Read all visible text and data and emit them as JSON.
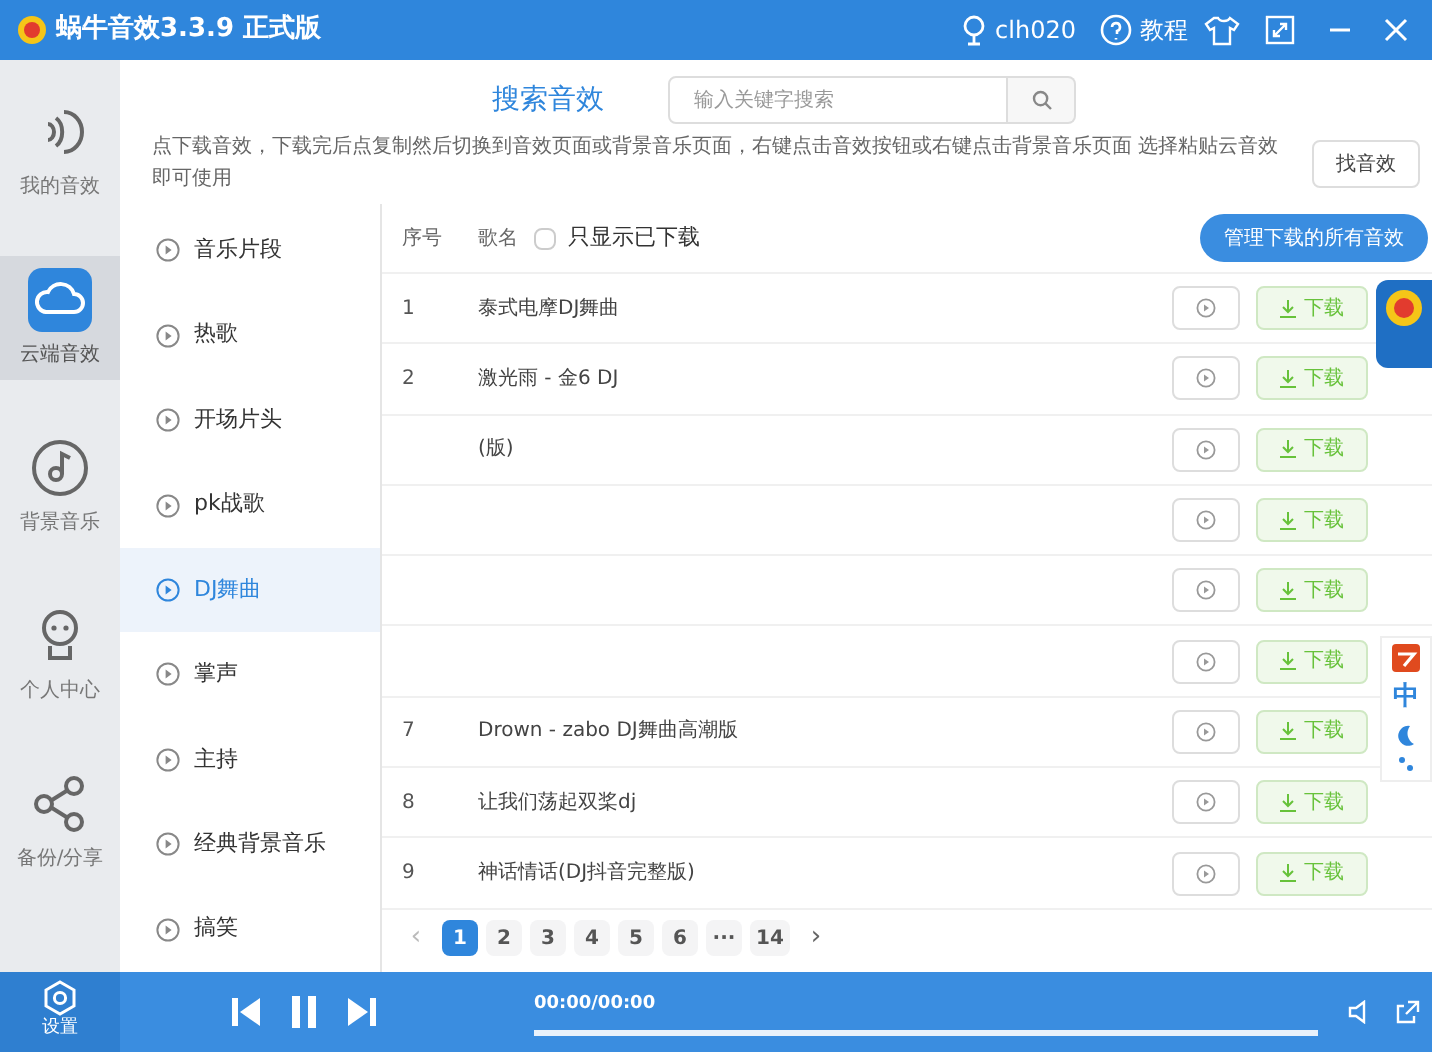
{
  "window": {
    "title": "蜗牛音效3.3.9 正式版",
    "user": "clh020",
    "help": "教程"
  },
  "nav": [
    {
      "label": "我的音效",
      "kind": "sound",
      "selected": false
    },
    {
      "label": "云端音效",
      "kind": "cloud",
      "selected": true
    },
    {
      "label": "背景音乐",
      "kind": "disc",
      "selected": false
    },
    {
      "label": "个人中心",
      "kind": "person",
      "selected": false
    },
    {
      "label": "备份/分享",
      "kind": "share",
      "selected": false
    }
  ],
  "settings": {
    "label": "设置"
  },
  "search": {
    "title": "搜索音效",
    "placeholder": "输入关键字搜索"
  },
  "notice": "点下载音效，下载完后点复制然后切换到音效页面或背景音乐页面，右键点击音效按钮或右键点击背景音乐页面 选择粘贴云音效即可使用",
  "find_button": "找音效",
  "categories": [
    {
      "label": "音乐片段",
      "selected": false
    },
    {
      "label": "热歌",
      "selected": false
    },
    {
      "label": "开场片头",
      "selected": false
    },
    {
      "label": "pk战歌",
      "selected": false
    },
    {
      "label": "DJ舞曲",
      "selected": true
    },
    {
      "label": "掌声",
      "selected": false
    },
    {
      "label": "主持",
      "selected": false
    },
    {
      "label": "经典背景音乐",
      "selected": false
    },
    {
      "label": "搞笑",
      "selected": false
    }
  ],
  "table": {
    "columns": [
      "序号",
      "歌名"
    ],
    "filter": {
      "label": "只显示已下载",
      "checked": false
    },
    "manage_button": "管理下载的所有音效",
    "rows": [
      {
        "index": "1",
        "title": "泰式电摩DJ舞曲",
        "download": "下载"
      },
      {
        "index": "2",
        "title": "激光雨 - 金6 DJ",
        "download": "下载"
      },
      {
        "title": "(版)",
        "download": "下载"
      },
      {
        "download": "下载"
      },
      {
        "download": "下载"
      },
      {
        "download": "下载"
      },
      {
        "index": "7",
        "title": "Drown - zabo DJ舞曲高潮版",
        "download": "下载"
      },
      {
        "index": "8",
        "title": "让我们荡起双桨dj",
        "download": "下载"
      },
      {
        "index": "9",
        "title": "神话情话(DJ抖音完整版)",
        "download": "下载"
      }
    ]
  },
  "pagination": {
    "prev": "‹",
    "next": "›",
    "pages": [
      {
        "label": "1",
        "selected": true
      },
      {
        "label": "2",
        "selected": false
      },
      {
        "label": "3",
        "selected": false
      },
      {
        "label": "4",
        "selected": false
      },
      {
        "label": "5",
        "selected": false
      },
      {
        "label": "6",
        "selected": false
      },
      {
        "label": "···",
        "selected": false
      },
      {
        "label": "14",
        "selected": false
      }
    ]
  },
  "player": {
    "time": "00:00/00:00"
  },
  "ime": {
    "label": "中"
  }
}
